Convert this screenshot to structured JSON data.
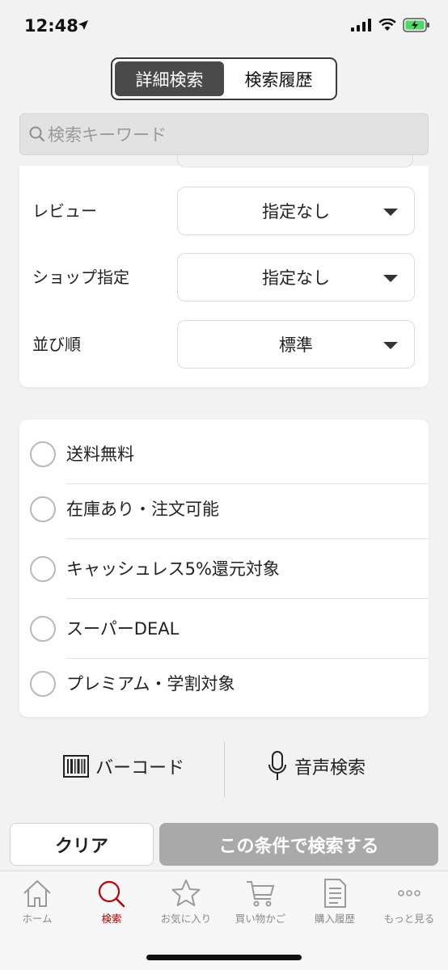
{
  "status_bar": {
    "time": "12:48"
  },
  "segmented": {
    "left": "詳細検索",
    "right": "検索履歴",
    "active": "left"
  },
  "search": {
    "placeholder": "検索キーワード"
  },
  "filters": [
    {
      "label": "レビュー",
      "value": "指定なし"
    },
    {
      "label": "ショップ指定",
      "value": "指定なし"
    },
    {
      "label": "並び順",
      "value": "標準"
    }
  ],
  "conditions": [
    {
      "label": "送料無料"
    },
    {
      "label": "在庫あり・注文可能"
    },
    {
      "label": "キャッシュレス5%還元対象"
    },
    {
      "label": "スーパーDEAL"
    },
    {
      "label": "プレミアム・学割対象"
    }
  ],
  "tools": {
    "barcode": "バーコード",
    "voice": "音声検索"
  },
  "actions": {
    "clear": "クリア",
    "submit": "この条件で検索する"
  },
  "tabs": [
    {
      "label": "ホーム",
      "icon": "home-icon"
    },
    {
      "label": "検索",
      "icon": "search-icon"
    },
    {
      "label": "お気に入り",
      "icon": "star-icon"
    },
    {
      "label": "買い物かご",
      "icon": "cart-icon"
    },
    {
      "label": "購入履歴",
      "icon": "history-icon"
    },
    {
      "label": "もっと見る",
      "icon": "more-icon"
    }
  ],
  "active_tab": "検索",
  "colors": {
    "accent": "#bf0000",
    "submit_disabled": "#a9a9a9",
    "segment_active": "#4a4a4a"
  }
}
